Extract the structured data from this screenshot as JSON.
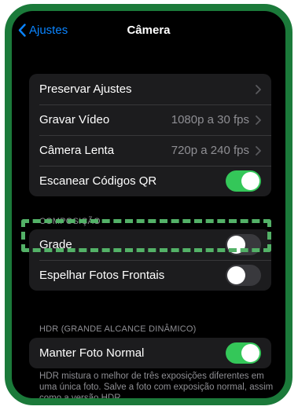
{
  "navbar": {
    "back_label": "Ajustes",
    "title": "Câmera"
  },
  "group1": {
    "rows": [
      {
        "label": "Preservar Ajustes",
        "value": ""
      },
      {
        "label": "Gravar Vídeo",
        "value": "1080p a 30 fps"
      },
      {
        "label": "Câmera Lenta",
        "value": "720p a 240 fps"
      },
      {
        "label": "Escanear Códigos QR",
        "toggle": "on"
      }
    ]
  },
  "composition": {
    "header": "COMPOSIÇÃO",
    "rows": [
      {
        "label": "Grade",
        "toggle": "off"
      },
      {
        "label": "Espelhar Fotos Frontais",
        "toggle": "off"
      }
    ]
  },
  "hdr": {
    "header": "HDR (GRANDE ALCANCE DINÂMICO)",
    "rows": [
      {
        "label": "Manter Foto Normal",
        "toggle": "on"
      }
    ],
    "footer": "HDR mistura o melhor de três exposições diferentes em uma única foto. Salve a foto com exposição normal, assim como a versão HDR."
  },
  "colors": {
    "accent_blue": "#0a84ff",
    "toggle_on": "#34c759",
    "frame_green": "#1b7a3a",
    "highlight_dashed": "#53b167"
  },
  "icons": {
    "back": "chevron-left-icon",
    "disclosure": "chevron-right-icon"
  }
}
